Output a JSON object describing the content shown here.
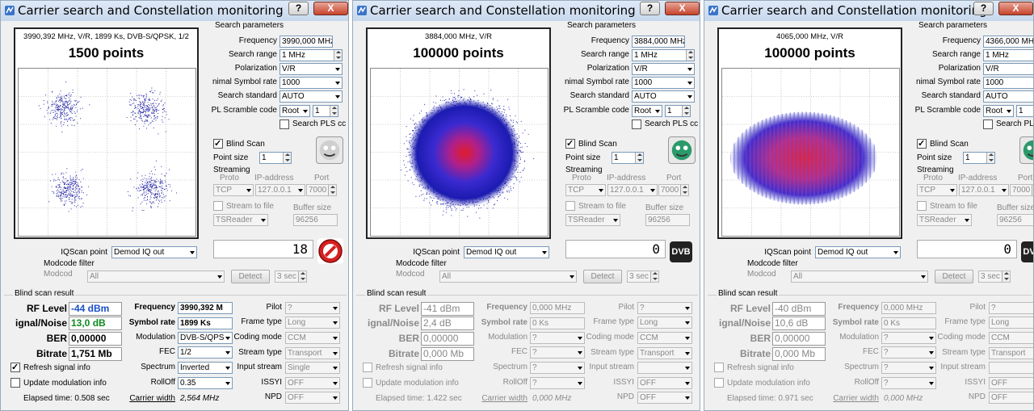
{
  "common": {
    "title": "Carrier search and Constellation monitoring",
    "help_label": "?",
    "close_label": "X",
    "search_params_heading": "Search parameters",
    "frequency_label": "Frequency",
    "search_range_label": "Search range",
    "polarization_label": "Polarization",
    "min_symbol_rate_label": "nimal Symbol rate",
    "search_standard_label": "Search standard",
    "pl_scramble_label": "PL Scramble code",
    "search_pls_label": "Search PLS cc",
    "blind_scan_label": "Blind Scan",
    "point_size_label": "Point size",
    "streaming_label": "Streaming",
    "proto_label": "Proto",
    "ip_label": "IP-address",
    "port_label": "Port",
    "stream_to_file_label": "Stream to file",
    "buffer_size_label": "Buffer size",
    "iqscan_label": "IQScan point",
    "modcode_filter_label": "Modcode filter",
    "modcode_label": "Modcod",
    "detect_label": "Detect",
    "blind_result_label": "Blind scan result",
    "rf_level_label": "RF Level",
    "snr_label": "ignal/Noise",
    "ber_label": "BER",
    "bitrate_label": "Bitrate",
    "frequency_res_label": "Frequency",
    "symbol_rate_label": "Symbol rate",
    "modulation_label": "Modulation",
    "fec_label": "FEC",
    "spectrum_label": "Spectrum",
    "rolloff_label": "RollOff",
    "carrier_width_label": "Carrier width",
    "pilot_label": "Pilot",
    "frame_type_label": "Frame type",
    "coding_mode_label": "Coding mode",
    "stream_type_label": "Stream type",
    "input_stream_label": "Input stream",
    "issyi_label": "ISSYI",
    "npd_label": "NPD",
    "refresh_label": "Refresh signal info",
    "update_mod_label": "Update modulation info"
  },
  "windows": [
    {
      "const_info": "3990,392 MHz, V/R, 1899 Ks, DVB-S/QPSK, 1/2",
      "points": "1500 points",
      "frequency": "3990,000 MHz",
      "search_range": "1 MHz",
      "polarization": "V/R",
      "min_symbol_rate": "1000",
      "search_standard": "AUTO",
      "pl_root": "Root",
      "pl_value": "1",
      "point_size": "1",
      "proto": "TCP",
      "ip": "127.0.0.1",
      "port": "7000",
      "stream_reader": "TSReader",
      "buffer_size": "96256",
      "iqscan": "Demod IQ out",
      "lcd": "18",
      "modcode": "All",
      "detect_interval": "3 sec",
      "rf_level": "-44 dBm",
      "snr": "13,0 dB",
      "ber": "0,00000",
      "bitrate": "1,751 Mb",
      "frequency_res": "3990,392 M",
      "symbol_rate": "1899 Ks",
      "modulation": "DVB-S/QPS",
      "fec": "1/2",
      "spectrum": "Inverted",
      "rolloff": "0.35",
      "carrier_width": "2,564 MHz",
      "pilot": "?",
      "frame_type": "Long",
      "coding_mode": "CCM",
      "stream_type": "Transport",
      "input_stream": "Single",
      "issyi": "OFF",
      "npd": "OFF",
      "elapsed": "Elapsed time: 0.508 sec",
      "rf_color": "#1a4fc8",
      "snr_color": "#0f8a1f"
    },
    {
      "const_info": "3884,000 MHz, V/R",
      "points": "100000 points",
      "frequency": "3884,000 MHz",
      "search_range": "1 MHz",
      "polarization": "V/R",
      "min_symbol_rate": "1000",
      "search_standard": "AUTO",
      "pl_root": "Root",
      "pl_value": "1",
      "point_size": "1",
      "proto": "TCP",
      "ip": "127.0.0.1",
      "port": "7000",
      "stream_reader": "TSReader",
      "buffer_size": "96256",
      "iqscan": "Demod IQ out",
      "lcd": "0",
      "modcode": "All",
      "detect_interval": "3 sec",
      "rf_level": "-41 dBm",
      "snr": "2,4 dB",
      "ber": "0,00000",
      "bitrate": "0,000 Mb",
      "frequency_res": "0,000 MHz",
      "symbol_rate": "0 Ks",
      "modulation": "?",
      "fec": "?",
      "spectrum": "?",
      "rolloff": "?",
      "carrier_width": "0,000 MHz",
      "pilot": "?",
      "frame_type": "Long",
      "coding_mode": "CCM",
      "stream_type": "Transport",
      "input_stream": "",
      "issyi": "OFF",
      "npd": "OFF",
      "elapsed": "Elapsed time: 1.422 sec"
    },
    {
      "const_info": "4065,000 MHz, V/R",
      "points": "100000 points",
      "frequency": "4366,000 MHz",
      "search_range": "1 MHz",
      "polarization": "V/R",
      "min_symbol_rate": "1000",
      "search_standard": "AUTO",
      "pl_root": "Root",
      "pl_value": "1",
      "point_size": "1",
      "proto": "TCP",
      "ip": "127.0.0.1",
      "port": "7000",
      "stream_reader": "TSReader",
      "buffer_size": "96256",
      "iqscan": "Demod IQ out",
      "lcd": "0",
      "modcode": "All",
      "detect_interval": "3 sec",
      "rf_level": "-40 dBm",
      "snr": "10,6 dB",
      "ber": "0,00000",
      "bitrate": "0,000 Mb",
      "frequency_res": "0,000 MHz",
      "symbol_rate": "0 Ks",
      "modulation": "?",
      "fec": "?",
      "spectrum": "?",
      "rolloff": "?",
      "carrier_width": "0,000 MHz",
      "pilot": "?",
      "frame_type": "Long",
      "coding_mode": "CCM",
      "stream_type": "Transport",
      "input_stream": "",
      "issyi": "OFF",
      "npd": "OFF",
      "elapsed": "Elapsed time: 0.971 sec"
    }
  ]
}
